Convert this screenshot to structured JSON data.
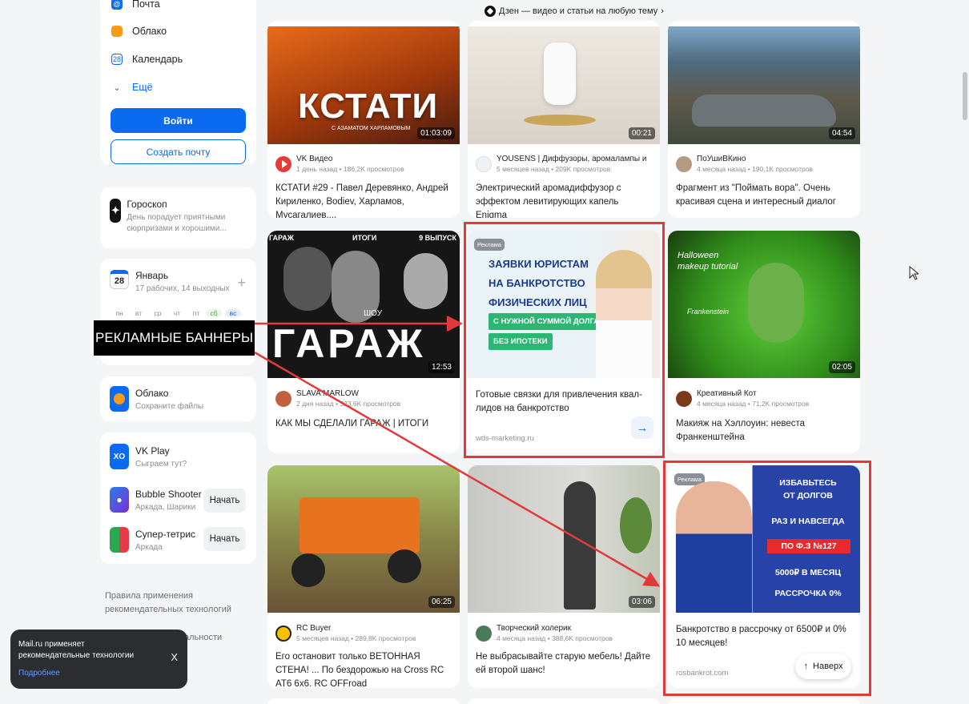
{
  "sidebar": {
    "services": [
      {
        "label": "Почта",
        "icon": "mail-icon"
      },
      {
        "label": "Облако",
        "icon": "cloud-icon"
      },
      {
        "label": "Календарь",
        "icon": "calendar-icon"
      },
      {
        "label": "Ещё",
        "icon": "chevron-down-icon"
      }
    ],
    "login_label": "Войти",
    "create_mail_label": "Создать почту",
    "horoscope": {
      "title": "Гороскоп",
      "text": "День порадует приятными сюрпризами и хорошими..."
    },
    "calendar": {
      "day": "28",
      "month": "Январь",
      "subtitle": "17 рабочих, 14 выходных",
      "weekdays": [
        "пн",
        "вт",
        "ср",
        "чт",
        "пт",
        "сб",
        "вс"
      ]
    },
    "cloud": {
      "title": "Облако",
      "text": "Сохраните файлы"
    },
    "vkplay": {
      "title": "VK Play",
      "text": "Сыграем тут?"
    },
    "games": [
      {
        "title": "Bubble Shooter",
        "genre": "Аркада, Шарики",
        "button": "Начать"
      },
      {
        "title": "Супер-тетрис",
        "genre": "Аркада",
        "button": "Начать"
      }
    ],
    "footer_links": [
      "Правила применения рекомендательных технологий",
      "альности"
    ]
  },
  "toast": {
    "text": "Mail.ru применяет рекомендательные технологии",
    "link": "Подробнее",
    "close": "X"
  },
  "dzen_bar": "Дзен — видео и статьи на любую тему",
  "callout": "РЕКЛАМНЫЕ БАННЕРЫ",
  "cards": [
    {
      "channel": "VK Видео",
      "stats": "1 день назад • 186,2K просмотров",
      "title": "КСТАТИ #29 - Павел Деревянко, Андрей Кириленко, Bodiev, Харламов, Мусагалиев,...",
      "duration": "01:03:09",
      "thumb_text": "КСТАТИ",
      "thumb_sub": "С АЗАМАТОМ ХАРЛАМОВЫМ"
    },
    {
      "channel": "YOUSENS | Диффузоры, аромалампы и инт...",
      "stats": "5 месяцев назад • 209K просмотров",
      "title": "Электрический аромадиффузор с эффектом левитирующих капель Enigma",
      "duration": "00:21"
    },
    {
      "channel": "ПоУшиВКино",
      "stats": "4 месяца назад • 190,1K просмотров",
      "title": "Фрагмент из \"Поймать вора\". Очень красивая сцена и интересный диалог",
      "duration": "04:54"
    },
    {
      "channel": "SLAVA MARLOW",
      "stats": "2 дня назад • 323,6K просмотров",
      "title": "КАК МЫ СДЕЛАЛИ ГАРАЖ | ИТОГИ",
      "duration": "12:53",
      "thumb_labels": [
        "ГАРАЖ",
        "ИТОГИ",
        "9 ВЫПУСК"
      ],
      "thumb_text": "ГАРАЖ",
      "thumb_sub": "ШОУ"
    },
    {
      "ad": true,
      "badge": "Реклама",
      "banner_lines": [
        "ЗАЯВКИ ЮРИСТАМ",
        "НА БАНКРОТСТВО",
        "ФИЗИЧЕСКИХ ЛИЦ"
      ],
      "banner_buttons": [
        "С НУЖНОЙ СУММОЙ ДОЛГА",
        "БЕЗ ИПОТЕКИ"
      ],
      "title": "Готовые связки для привлечения квал-лидов на банкротство",
      "domain": "wds-marketing.ru"
    },
    {
      "channel": "Креативный Кот",
      "stats": "4 месяца назад • 71,2K просмотров",
      "title": "Макияж на Хэллоуин: невеста Франкенштейна",
      "duration": "02:05",
      "thumb_text": "Halloween makeup tutorial",
      "thumb_sub": "Frankenstein"
    },
    {
      "channel": "RC Buyer",
      "stats": "5 месяцев назад • 289,8K просмотров",
      "title": "Его остановит только ВЕТОННАЯ СТЕНА! ... По бездорожью на Cross RC AT6 6x6. RC OFFroad",
      "duration": "06:25"
    },
    {
      "channel": "Творческий холерик",
      "stats": "4 месяца назад • 388,6K просмотров",
      "title": "Не выбрасывайте старую мебель! Дайте ей второй шанс!",
      "duration": "03:06"
    },
    {
      "ad": true,
      "badge": "Реклама",
      "banner_lines": [
        "ИЗБАВЬТЕСЬ",
        "ОТ ДОЛГОВ",
        "РАЗ И НАВСЕГДА",
        "ПО Ф.З №127",
        "5000₽ В МЕСЯЦ",
        "РАССРОЧКА 0%"
      ],
      "title": "Банкротство в рассрочку от 6500₽ и 0% 10 месяцев!",
      "domain": "rosbankrot.com"
    }
  ],
  "up_button": "Наверх",
  "colors": {
    "accent": "#0a6af0",
    "frame": "#e23a3a"
  }
}
